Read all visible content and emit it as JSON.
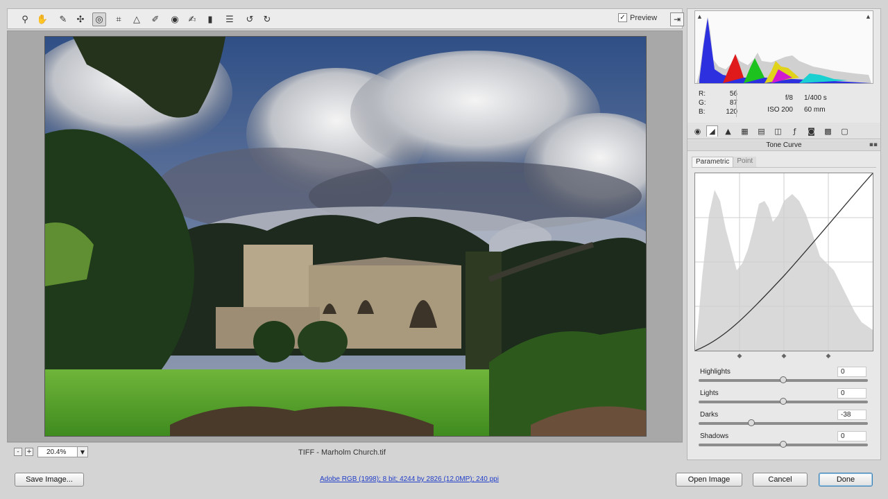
{
  "toolbar": {
    "tools": [
      {
        "name": "zoom-tool",
        "glyph": "⚲"
      },
      {
        "name": "hand-tool",
        "glyph": "✋"
      },
      {
        "name": "white-balance-tool",
        "glyph": "✎"
      },
      {
        "name": "color-sampler-tool",
        "glyph": "✣"
      },
      {
        "name": "targeted-adjustment-tool",
        "glyph": "◎"
      },
      {
        "name": "crop-tool",
        "glyph": "⌗"
      },
      {
        "name": "straighten-tool",
        "glyph": "△"
      },
      {
        "name": "spot-removal-tool",
        "glyph": "✐"
      },
      {
        "name": "red-eye-tool",
        "glyph": "◉"
      },
      {
        "name": "adjustment-brush-tool",
        "glyph": "✍"
      },
      {
        "name": "graduated-filter-tool",
        "glyph": "▮"
      },
      {
        "name": "preferences-tool",
        "glyph": "☰"
      },
      {
        "name": "rotate-left-tool",
        "glyph": "↺"
      },
      {
        "name": "rotate-right-tool",
        "glyph": "↻"
      }
    ],
    "preview_label": "Preview",
    "preview_checked": "✓"
  },
  "status": {
    "zoom_value": "20.4%",
    "zoom_minus": "-",
    "zoom_plus": "+",
    "file_title": "TIFF  - Marholm Church.tif"
  },
  "info": {
    "r_label": "R:",
    "r_value": "56",
    "g_label": "G:",
    "g_value": "87",
    "b_label": "B:",
    "b_value": "120",
    "aperture": "f/8",
    "shutter": "1/400 s",
    "iso": "ISO 200",
    "focal": "60 mm"
  },
  "panel": {
    "title": "Tone Curve",
    "subtab_parametric": "Parametric",
    "subtab_point": "Point"
  },
  "sliders": [
    {
      "label": "Highlights",
      "value": "0",
      "level": 0
    },
    {
      "label": "Lights",
      "value": "0",
      "level": 0
    },
    {
      "label": "Darks",
      "value": "-38",
      "level": -38
    },
    {
      "label": "Shadows",
      "value": "0",
      "level": 0
    }
  ],
  "bottom": {
    "save_label": "Save Image...",
    "workflow_link": "Adobe RGB (1998); 8 bit; 4244 by 2826 (12.0MP); 240 ppi",
    "open_label": "Open Image",
    "cancel_label": "Cancel",
    "done_label": "Done"
  },
  "colors": {
    "link": "#1f3cc8",
    "done_border": "#3c7fb1"
  }
}
